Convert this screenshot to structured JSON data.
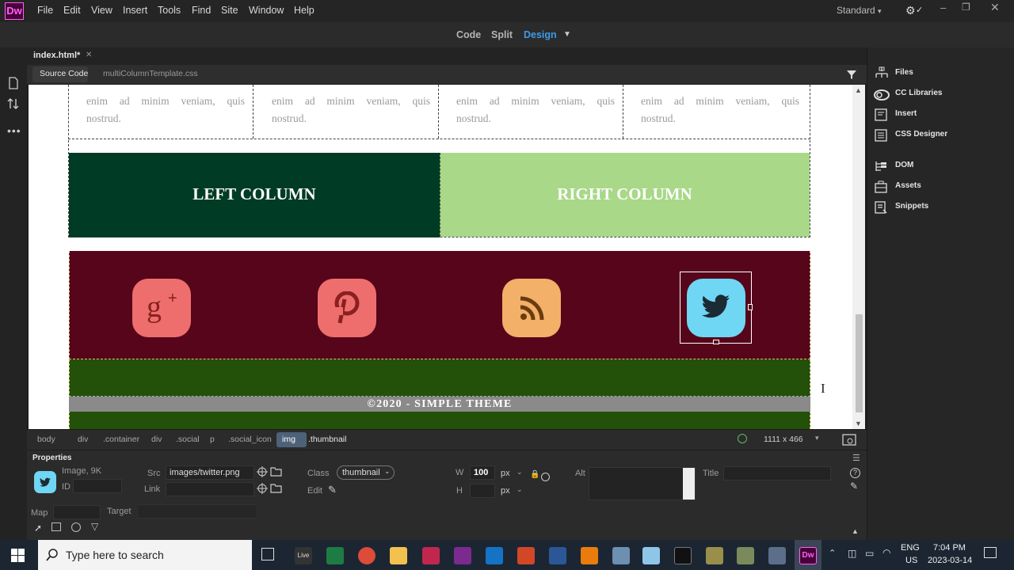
{
  "app": {
    "logo": "Dw",
    "workspace": "Standard"
  },
  "menu": [
    "File",
    "Edit",
    "View",
    "Insert",
    "Tools",
    "Find",
    "Site",
    "Window",
    "Help"
  ],
  "view_switcher": {
    "code": "Code",
    "split": "Split",
    "design": "Design"
  },
  "document": {
    "tab": "index.html*",
    "source_code": "Source Code",
    "related_file": "multiColumnTemplate.css"
  },
  "canvas": {
    "body_text": "enim ad minim veniam, quis nostrud.",
    "left_column": "LEFT COLUMN",
    "right_column": "RIGHT COLUMN",
    "footer": "©2020 - SIMPLE THEME",
    "colors": {
      "left": "#003c25",
      "right": "#a8d888",
      "social_bg": "#56051a",
      "footer_bg": "#235109",
      "footer_bar": "#8a8a8a"
    },
    "social_icons": [
      {
        "name": "google-plus-icon",
        "glyph": "g+",
        "color": "#ee6e6e"
      },
      {
        "name": "pinterest-icon",
        "glyph": "p",
        "color": "#ee6e6e"
      },
      {
        "name": "rss-icon",
        "glyph": "rss",
        "color": "#f2b068"
      },
      {
        "name": "twitter-icon",
        "glyph": "bird",
        "color": "#6fd6f4"
      }
    ]
  },
  "right_panel": [
    "Files",
    "CC Libraries",
    "Insert",
    "CSS Designer",
    "DOM",
    "Assets",
    "Snippets"
  ],
  "tag_selector": {
    "tags": [
      "body",
      "div",
      ".container",
      "div",
      ".social",
      "p",
      ".social_icon",
      "img",
      ".thumbnail"
    ],
    "dimensions": "1111 x 466"
  },
  "properties": {
    "title": "Properties",
    "type": "Image, 9K",
    "id_label": "ID",
    "src_label": "Src",
    "src_value": "images/twitter.png",
    "link_label": "Link",
    "class_label": "Class",
    "class_value": "thumbnail",
    "edit_label": "Edit",
    "w_label": "W",
    "w_value": "100",
    "w_unit": "px",
    "h_label": "H",
    "h_unit": "px",
    "alt_label": "Alt",
    "title_label": "Title",
    "map_label": "Map",
    "target_label": "Target"
  },
  "taskbar": {
    "search_placeholder": "Type here to search",
    "lang_1": "ENG",
    "lang_2": "US",
    "time": "7:04 PM",
    "date": "2023-03-14"
  }
}
